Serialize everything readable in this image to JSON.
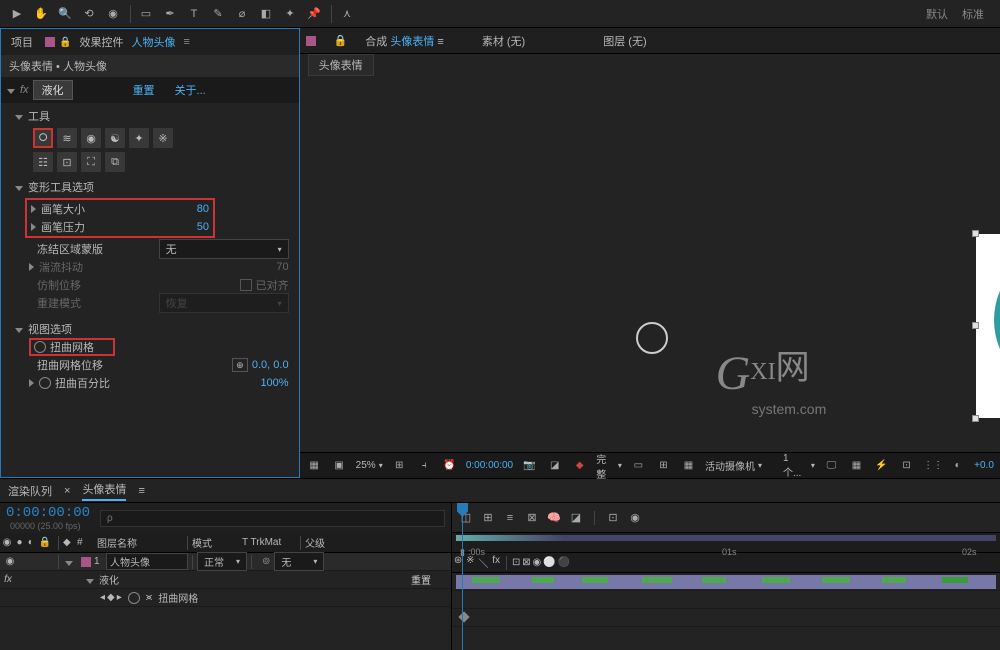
{
  "toolbar": {
    "right_items": [
      "默认",
      "标准"
    ]
  },
  "panels": {
    "left_tabs": {
      "project": "项目",
      "effect_controls": "效果控件",
      "target": "人物头像"
    },
    "subheader": "头像表情 • 人物头像",
    "effect": {
      "fx": "fx",
      "name": "液化",
      "reset": "重置",
      "about": "关于..."
    },
    "sections": {
      "tools": "工具",
      "distort_opts": "变形工具选项",
      "brush_size_label": "画笔大小",
      "brush_size_val": "80",
      "brush_pressure_label": "画笔压力",
      "brush_pressure_val": "50",
      "freeze_label": "冻结区域蒙版",
      "freeze_val": "无",
      "turb_label": "湍流抖动",
      "turb_val": "70",
      "clone_label": "仿制位移",
      "clone_check": "已对齐",
      "rebuild_label": "重建模式",
      "rebuild_val": "恢复",
      "view_opts": "视图选项",
      "distort_mesh": "扭曲网格",
      "mesh_offset_label": "扭曲网格位移",
      "mesh_offset_val": "0.0, 0.0",
      "distort_pct_label": "扭曲百分比",
      "distort_pct_val": "100%"
    }
  },
  "center": {
    "tabs": {
      "comp": "合成",
      "comp_name": "头像表情",
      "footage": "素材 (无)",
      "layer": "图层 (无)"
    },
    "subtab": "头像表情"
  },
  "watermark": {
    "g": "G",
    "xi": "XI",
    "wang": "网",
    "sub": "system.com"
  },
  "viewer_footer": {
    "zoom": "25%",
    "time": "0:00:00:00",
    "res": "完整",
    "camera": "活动摄像机",
    "views": "1 个...",
    "offset": "+0.0"
  },
  "timeline": {
    "tabs": {
      "render": "渲染队列",
      "comp": "头像表情"
    },
    "timecode": "0:00:00:00",
    "timecode_sub": "00000 (25.00 fps)",
    "search_placeholder": "ρ",
    "cols": {
      "layer_name": "图层名称",
      "mode": "模式",
      "trkmat": "T TrkMat",
      "parent": "父级"
    },
    "layer1": {
      "num": "1",
      "name": "人物头像",
      "mode": "正常",
      "parent": "无"
    },
    "effect_row": "液化",
    "prop_row": "扭曲网格",
    "reset_btn": "重置",
    "ruler": {
      "t0": ":00s",
      "t1": "01s",
      "t2": "02s"
    }
  }
}
